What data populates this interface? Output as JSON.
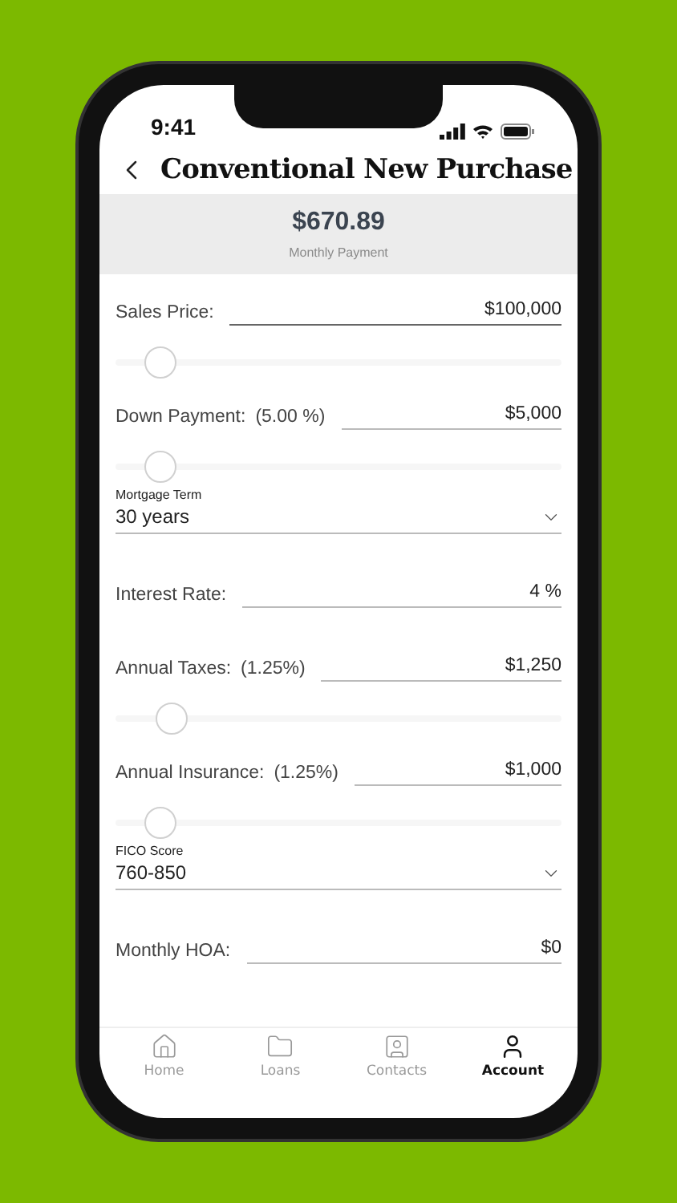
{
  "status_bar": {
    "time": "9:41"
  },
  "header": {
    "title": "Conventional New Purchase"
  },
  "summary": {
    "amount": "$670.89",
    "caption": "Monthly Payment"
  },
  "fields": [
    {
      "kind": "input",
      "label": "Sales Price:",
      "value": "$100,000"
    },
    {
      "kind": "slider",
      "level": 0.1
    },
    {
      "kind": "input",
      "label": "Down Payment:",
      "note": "(5.00 %)",
      "value": "$5,000"
    },
    {
      "kind": "slider",
      "level": 0.1
    },
    {
      "kind": "dropdown",
      "label": "Mortgage Term",
      "value": "30 years"
    },
    {
      "kind": "input",
      "label": "Interest Rate:",
      "value": "4 %"
    },
    {
      "kind": "input",
      "label": "Annual Taxes:",
      "note": "(1.25%)",
      "value": "$1,250"
    },
    {
      "kind": "slider",
      "level": 0.125
    },
    {
      "kind": "input",
      "label": "Annual Insurance:",
      "note": "(1.25%)",
      "value": "$1,000"
    },
    {
      "kind": "slider",
      "level": 0.1
    },
    {
      "kind": "dropdown",
      "label": "FICO Score",
      "value": "760-850"
    },
    {
      "kind": "input",
      "label": "Monthly HOA:",
      "value": "$0"
    }
  ],
  "tab_bar": [
    {
      "label": "Home",
      "selected": false
    },
    {
      "label": "Loans",
      "selected": false
    },
    {
      "label": "Contacts",
      "selected": false
    },
    {
      "label": "Account",
      "selected": true
    }
  ]
}
